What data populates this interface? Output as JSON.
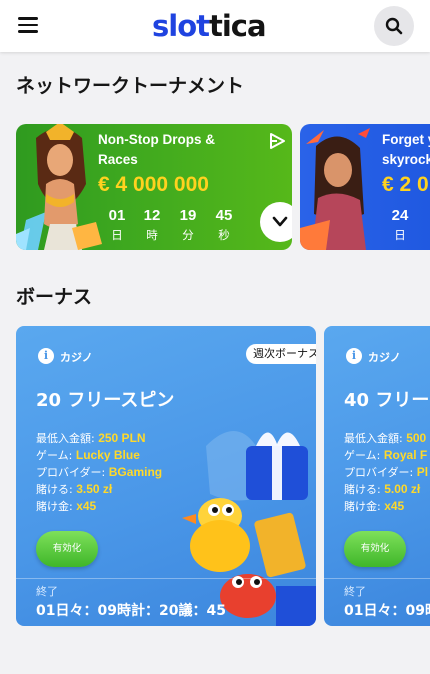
{
  "header": {
    "logo_part1": "slot",
    "logo_part2": "tica"
  },
  "tournaments": {
    "section_title": "ネットワークトーナメント",
    "cards": [
      {
        "title_line1": "Non-Stop Drops &",
        "title_line2": "Races",
        "prize": "€ 4 000 000",
        "countdown": [
          {
            "value": "01",
            "unit": "日"
          },
          {
            "value": "12",
            "unit": "時"
          },
          {
            "value": "19",
            "unit": "分"
          },
          {
            "value": "45",
            "unit": "秒"
          }
        ]
      },
      {
        "title_line1": "Forget y",
        "title_line2": "skyrock",
        "prize": "€ 2 0",
        "countdown": [
          {
            "value": "24",
            "unit": "日"
          }
        ]
      }
    ]
  },
  "bonuses": {
    "section_title": "ボーナス",
    "cards": [
      {
        "category": "カジノ",
        "badge": "週次ボーナス",
        "title": "20 フリースピン",
        "rows": [
          {
            "key": "最低入金額: ",
            "value": "250 PLN"
          },
          {
            "key": "ゲーム: ",
            "value": "Lucky Blue"
          },
          {
            "key": "プロバイダー: ",
            "value": "BGaming"
          },
          {
            "key": "賭ける: ",
            "value": "3.50 zł"
          },
          {
            "key": "賭け金: ",
            "value": "x45"
          }
        ],
        "activate_label": "有効化",
        "ends_label": "終了",
        "ends_value": "01日々：09時計：20議：45"
      },
      {
        "category": "カジノ",
        "title": "40 フリー",
        "rows": [
          {
            "key": "最低入金額: ",
            "value": "500"
          },
          {
            "key": "ゲーム: ",
            "value": "Royal F"
          },
          {
            "key": "プロバイダー: ",
            "value": "Pl"
          },
          {
            "key": "賭ける: ",
            "value": "5.00 zł"
          },
          {
            "key": "賭け金: ",
            "value": "x45"
          }
        ],
        "activate_label": "有効化",
        "ends_label": "終了",
        "ends_value": "01日々：09時"
      }
    ]
  },
  "colors": {
    "brand_blue": "#1f43e0",
    "prize_yellow": "#ffd21f",
    "tournament_green": "#3ea81f",
    "tournament_blue": "#1f58e0",
    "bonus_blue": "#4a97e8",
    "activate_green": "#3fb62a"
  }
}
